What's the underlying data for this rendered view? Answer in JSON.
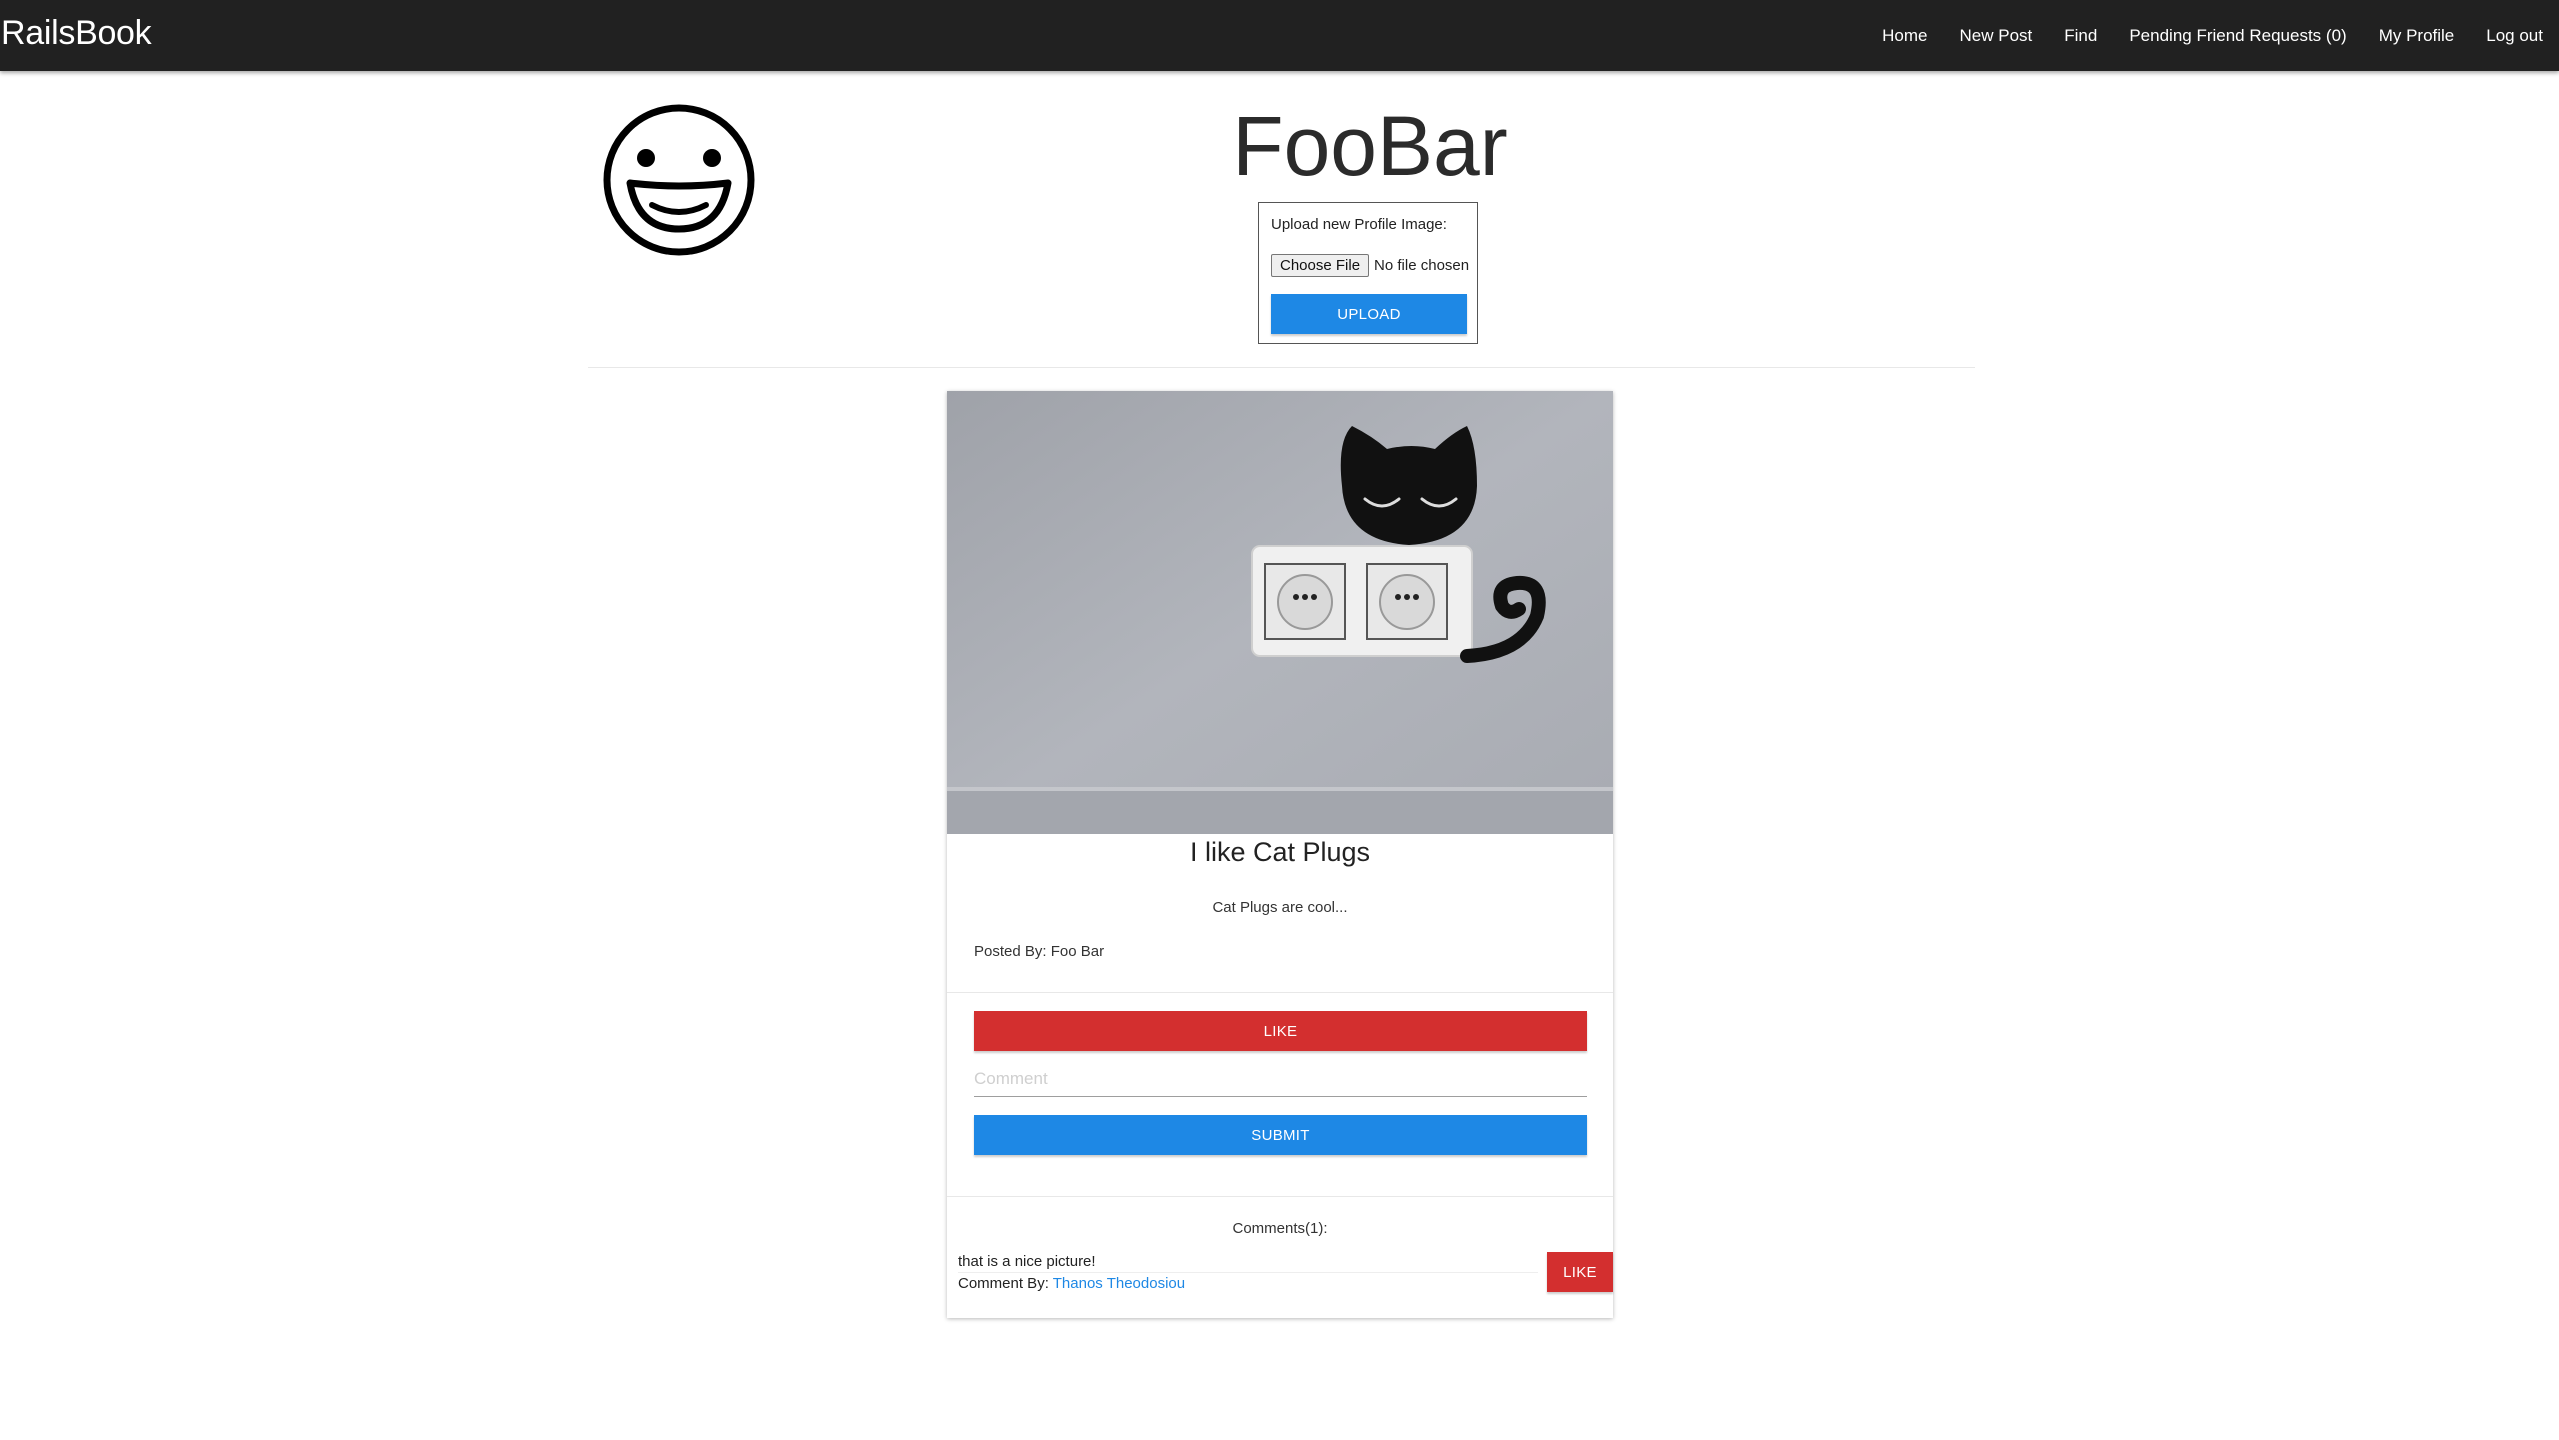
{
  "navbar": {
    "brand": "RailsBook",
    "links": [
      {
        "label": "Home"
      },
      {
        "label": "New Post"
      },
      {
        "label": "Find"
      },
      {
        "label": "Pending Friend Requests (0)"
      },
      {
        "label": "My Profile"
      },
      {
        "label": "Log out"
      }
    ]
  },
  "profile": {
    "avatar_icon": "smiley-face-icon",
    "name": "FooBar",
    "upload": {
      "label": "Upload new Profile Image:",
      "choose_file_label": "Choose File",
      "file_status": "No file chosen",
      "upload_button": "UPLOAD"
    }
  },
  "post": {
    "image_description_icon": "cat-plug-photo",
    "title": "I like Cat Plugs",
    "body": "Cat Plugs are cool...",
    "posted_by": "Posted By: Foo Bar",
    "like_button": "LIKE",
    "comment_placeholder": "Comment",
    "comment_value": "",
    "submit_button": "SUBMIT",
    "comments_heading": "Comments(1):",
    "comments": [
      {
        "text": "that is a nice picture!",
        "by_prefix": "Comment By: ",
        "author": "Thanos Theodosiou",
        "like_button": "LIKE"
      }
    ]
  },
  "colors": {
    "navbar_bg": "#212121",
    "primary_blue": "#1e88e5",
    "like_red": "#d32f2f"
  }
}
